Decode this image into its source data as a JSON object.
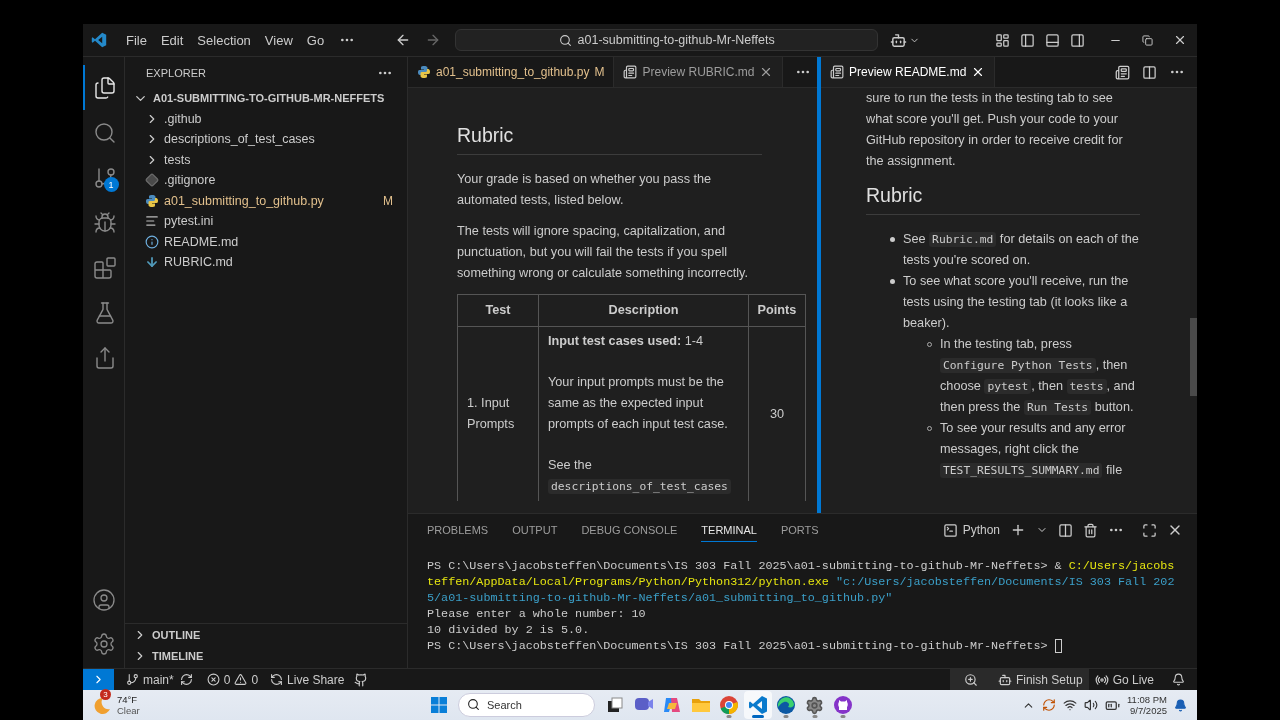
{
  "title_bar": {
    "menus": [
      "File",
      "Edit",
      "Selection",
      "View",
      "Go"
    ],
    "command_center": "a01-submitting-to-github-Mr-Neffets"
  },
  "activity_bar": {
    "items": [
      {
        "kind": "explorer",
        "selected": true
      },
      {
        "kind": "search",
        "selected": false
      },
      {
        "kind": "source_control",
        "selected": false,
        "badge": "1"
      },
      {
        "kind": "debug",
        "selected": false
      },
      {
        "kind": "extensions",
        "selected": false
      },
      {
        "kind": "testing",
        "selected": false
      },
      {
        "kind": "live_share",
        "selected": false
      }
    ]
  },
  "sidebar": {
    "title": "EXPLORER",
    "root": {
      "label": "A01-SUBMITTING-TO-GITHUB-MR-NEFFETS",
      "expanded": true,
      "children": [
        {
          "label": ".github",
          "kind": "folder",
          "expanded": false,
          "modified": false
        },
        {
          "label": "descriptions_of_test_cases",
          "kind": "folder",
          "expanded": false,
          "modified": false
        },
        {
          "label": "tests",
          "kind": "folder",
          "expanded": false,
          "modified": false
        },
        {
          "label": ".gitignore",
          "kind": "git",
          "modified": false
        },
        {
          "label": "a01_submitting_to_github.py",
          "kind": "python",
          "modified": true,
          "status": "M"
        },
        {
          "label": "pytest.ini",
          "kind": "config",
          "modified": false
        },
        {
          "label": "README.md",
          "kind": "info",
          "modified": false
        },
        {
          "label": "RUBRIC.md",
          "kind": "markdown",
          "modified": false
        }
      ]
    },
    "sections": [
      {
        "label": "OUTLINE",
        "expanded": false
      },
      {
        "label": "TIMELINE",
        "expanded": false
      }
    ]
  },
  "editor_groups": [
    {
      "focused": false,
      "tabs": [
        {
          "label": "a01_submitting_to_github.py",
          "kind": "python",
          "selected": false,
          "modified": true,
          "status": "M"
        },
        {
          "label": "Preview RUBRIC.md",
          "kind": "preview",
          "selected": true,
          "modified": false
        }
      ],
      "blocks": [
        {
          "kind": "heading",
          "text": "Rubric"
        },
        {
          "kind": "paragraph",
          "parts": [
            {
              "kind": "text",
              "text": "Your grade is based on whether you pass the automated tests, listed below."
            }
          ]
        },
        {
          "kind": "paragraph",
          "parts": [
            {
              "kind": "text",
              "text": "The tests will ignore spacing, capitalization, and punctuation, but you will fail the tests if you spell something wrong or calculate something incorrectly."
            }
          ]
        },
        {
          "kind": "table",
          "columns": [
            "Test",
            "Description",
            "Points"
          ],
          "rows": [
            {
              "test": "1. Input Prompts",
              "points": "30",
              "description": [
                [
                  {
                    "kind": "text",
                    "text": "**Input test cases used:** 1-4"
                  }
                ],
                [
                  {
                    "kind": "text",
                    "text": "Your input prompts must be the same as the expected input prompts of each input test case."
                  }
                ],
                [
                  {
                    "kind": "text",
                    "text": "See the "
                  },
                  {
                    "kind": "code",
                    "text": "descriptions_of_test_cases"
                  }
                ]
              ]
            }
          ]
        }
      ]
    },
    {
      "focused": true,
      "tabs": [
        {
          "label": "Preview README.md",
          "kind": "preview",
          "selected": true,
          "modified": false
        }
      ],
      "blocks": [
        {
          "kind": "paragraph",
          "parts": [
            {
              "kind": "text",
              "text": "sure to run the tests in the testing tab to see what score you'll get. Push your code to your GitHub repository in order to receive credit for the assignment."
            }
          ]
        },
        {
          "kind": "heading",
          "text": "Rubric"
        },
        {
          "kind": "list",
          "items": [
            {
              "parts": [
                {
                  "kind": "text",
                  "text": "See "
                },
                {
                  "kind": "code",
                  "text": "Rubric.md"
                },
                {
                  "kind": "text",
                  "text": " for details on each of the tests you're scored on."
                }
              ]
            },
            {
              "parts": [
                {
                  "kind": "text",
                  "text": "To see what score you'll receive, run the tests using the testing tab (it looks like a beaker)."
                }
              ],
              "children": [
                {
                  "parts": [
                    {
                      "kind": "text",
                      "text": "In the testing tab, press "
                    },
                    {
                      "kind": "code",
                      "text": "Configure Python Tests"
                    },
                    {
                      "kind": "text",
                      "text": ", then choose "
                    },
                    {
                      "kind": "code",
                      "text": "pytest"
                    },
                    {
                      "kind": "text",
                      "text": ", then "
                    },
                    {
                      "kind": "code",
                      "text": "tests"
                    },
                    {
                      "kind": "text",
                      "text": ", and then press the "
                    },
                    {
                      "kind": "code",
                      "text": "Run Tests"
                    },
                    {
                      "kind": "text",
                      "text": " button."
                    }
                  ]
                },
                {
                  "parts": [
                    {
                      "kind": "text",
                      "text": "To see your results and any error messages, right click the "
                    },
                    {
                      "kind": "code",
                      "text": "TEST_RESULTS_SUMMARY.md"
                    },
                    {
                      "kind": "text",
                      "text": " file"
                    }
                  ]
                }
              ]
            }
          ]
        }
      ]
    }
  ],
  "panel": {
    "tabs": [
      {
        "label": "PROBLEMS",
        "selected": false
      },
      {
        "label": "OUTPUT",
        "selected": false
      },
      {
        "label": "DEBUG CONSOLE",
        "selected": false
      },
      {
        "label": "TERMINAL",
        "selected": true
      },
      {
        "label": "PORTS",
        "selected": false
      }
    ],
    "terminal": {
      "profile": "Python",
      "cursor_visible": true,
      "lines": [
        [
          {
            "kind": "plain",
            "text": "PS C:\\Users\\jacobsteffen\\Documents\\IS 303 Fall 2025\\a01-submitting-to-github-Mr-Neffets> & "
          },
          {
            "kind": "command",
            "text": "C:/Users/jacobs"
          }
        ],
        [
          {
            "kind": "command",
            "text": "teffen/AppData/Local/Programs/Python/Python312/python.exe"
          },
          {
            "kind": "string",
            "text": " \"c:/Users/jacobsteffen/Documents/IS 303 Fall 202"
          }
        ],
        [
          {
            "kind": "string",
            "text": "5/a01-submitting-to-github-Mr-Neffets/a01_submitting_to_github.py\""
          }
        ],
        [
          {
            "kind": "plain",
            "text": "Please enter a whole number: 10"
          }
        ],
        [
          {
            "kind": "plain",
            "text": "10 divided by 2 is 5.0."
          }
        ],
        [
          {
            "kind": "plain",
            "text": "PS C:\\Users\\jacobsteffen\\Documents\\IS 303 Fall 2025\\a01-submitting-to-github-Mr-Neffets> "
          }
        ]
      ]
    }
  },
  "status_bar": {
    "branch": "main*",
    "errors": "0",
    "warnings": "0",
    "live_share": "Live Share",
    "right": [
      {
        "kind": "zoom"
      },
      {
        "kind": "setup",
        "label": "Finish Setup"
      },
      {
        "kind": "live",
        "label": "Go Live"
      },
      {
        "kind": "bell"
      }
    ]
  },
  "taskbar": {
    "weather": {
      "badge": "3",
      "temp": "74°F",
      "condition": "Clear"
    },
    "search": {
      "placeholder": "Search"
    },
    "apps": [
      {
        "kind": "task_view",
        "running": false,
        "selected": false
      },
      {
        "kind": "chat",
        "running": false,
        "selected": false
      },
      {
        "kind": "copilot",
        "running": false,
        "selected": false
      },
      {
        "kind": "files",
        "running": false,
        "selected": false
      },
      {
        "kind": "chrome",
        "running": true,
        "selected": false
      },
      {
        "kind": "vscode",
        "running": true,
        "selected": true
      },
      {
        "kind": "edge",
        "running": true,
        "selected": false
      },
      {
        "kind": "settings",
        "running": true,
        "selected": false
      },
      {
        "kind": "github",
        "running": true,
        "selected": false
      }
    ],
    "clock": {
      "time": "11:08 PM",
      "date": "9/7/2025"
    }
  }
}
